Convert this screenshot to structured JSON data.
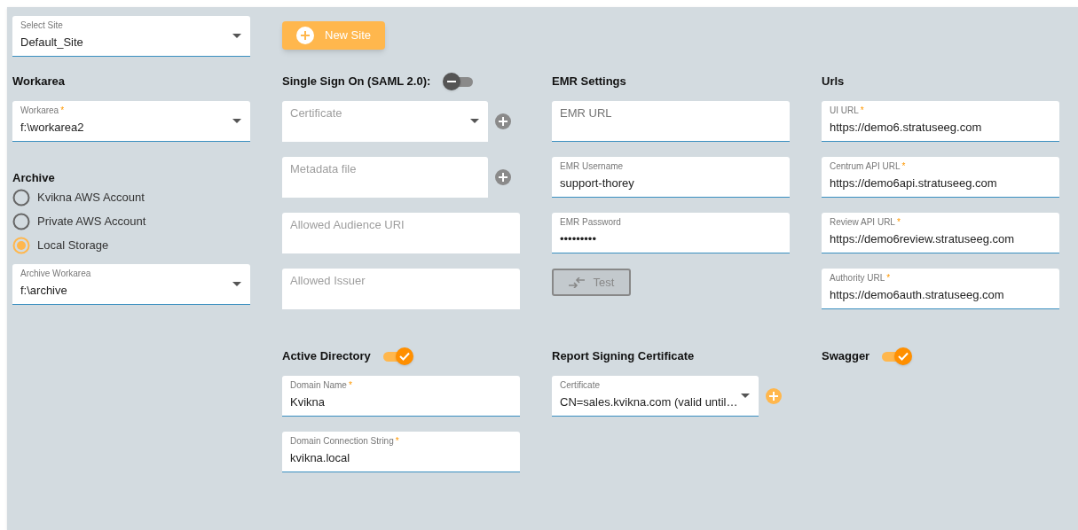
{
  "site_select": {
    "label": "Select Site",
    "value": "Default_Site"
  },
  "new_site_button": {
    "label": "New Site"
  },
  "rows": [
    [
      {
        "sections": [
          {
            "heading": "Workarea",
            "items": [
              {
                "kind": "select",
                "label": "Workarea",
                "required_mark": "*",
                "value": "f:\\workarea2"
              }
            ]
          },
          {
            "heading": "Archive",
            "items": [
              {
                "kind": "radio",
                "label": "Kvikna AWS Account",
                "selected": false
              },
              {
                "kind": "radio",
                "label": "Private AWS Account",
                "selected": false
              },
              {
                "kind": "radio",
                "label": "Local Storage",
                "selected": true
              },
              {
                "kind": "select",
                "label": "Archive Workarea",
                "value": "f:\\archive"
              }
            ]
          }
        ]
      },
      {
        "sections": [
          {
            "heading": "Single Sign On (SAML 2.0):",
            "toggle_on": false,
            "items": [
              {
                "kind": "select",
                "placeholder": "Certificate",
                "disabled": true,
                "add": true
              },
              {
                "kind": "text",
                "placeholder": "Metadata file",
                "disabled": true,
                "add": true
              },
              {
                "kind": "text",
                "placeholder": "Allowed Audience URI",
                "disabled": true
              },
              {
                "kind": "text",
                "placeholder": "Allowed Issuer",
                "disabled": true
              }
            ]
          }
        ]
      },
      {
        "sections": [
          {
            "heading": "EMR Settings",
            "items": [
              {
                "kind": "text",
                "placeholder": "EMR URL"
              },
              {
                "kind": "text",
                "label": "EMR Username",
                "value": "support-thorey"
              },
              {
                "kind": "text",
                "label": "EMR Password",
                "value": "•••••••••"
              },
              {
                "kind": "button",
                "label": "Test",
                "disabled": true
              }
            ]
          }
        ]
      },
      {
        "sections": [
          {
            "heading": "Urls",
            "items": [
              {
                "kind": "text",
                "label": "UI URL",
                "required_mark": "*",
                "value": "https://demo6.stratuseeg.com"
              },
              {
                "kind": "text",
                "label": "Centrum API URL",
                "required_mark": "*",
                "value": "https://demo6api.stratuseeg.com"
              },
              {
                "kind": "text",
                "label": "Review API URL",
                "required_mark": "*",
                "value": "https://demo6review.stratuseeg.com"
              },
              {
                "kind": "text",
                "label": "Authority URL",
                "required_mark": "*",
                "value": "https://demo6auth.stratuseeg.com"
              }
            ]
          }
        ]
      }
    ],
    [
      {},
      {
        "sections": [
          {
            "heading": "Active Directory",
            "toggle_on": true,
            "items": [
              {
                "kind": "text",
                "label": "Domain Name",
                "required_mark": "*",
                "value": "Kvikna"
              },
              {
                "kind": "text",
                "label": "Domain Connection String",
                "required_mark": "*",
                "value": "kvikna.local"
              }
            ]
          }
        ]
      },
      {
        "sections": [
          {
            "heading": "Report Signing Certificate",
            "items": [
              {
                "kind": "select",
                "label": "Certificate",
                "value": "CN=sales.kvikna.com (valid until…",
                "add": true
              }
            ]
          }
        ]
      },
      {
        "sections": [
          {
            "heading": "Swagger",
            "toggle_on": true
          }
        ]
      }
    ]
  ]
}
